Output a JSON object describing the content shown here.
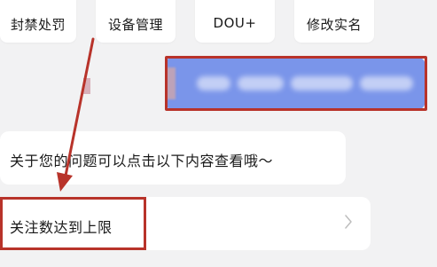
{
  "quick_actions": [
    {
      "label": "封禁处罚",
      "icon": "penalty-icon",
      "color": "#f5a45a"
    },
    {
      "label": "设备管理",
      "icon": "device-icon",
      "color": "#f07f7a"
    },
    {
      "label": "DOU+",
      "icon": "dou-plus-icon",
      "color": "#f07f7a"
    },
    {
      "label": "修改实名",
      "icon": "real-name-icon",
      "color": "#7fcf8f"
    }
  ],
  "user_message": {
    "bubble_color": "#7a95ea",
    "text": ""
  },
  "bot_reply": {
    "text": "关于您的问题可以点击以下内容查看哦～"
  },
  "link_row": {
    "label": "关注数达到上限",
    "chevron": "chevron-right-icon"
  },
  "annotation": {
    "color": "#b8332a"
  }
}
